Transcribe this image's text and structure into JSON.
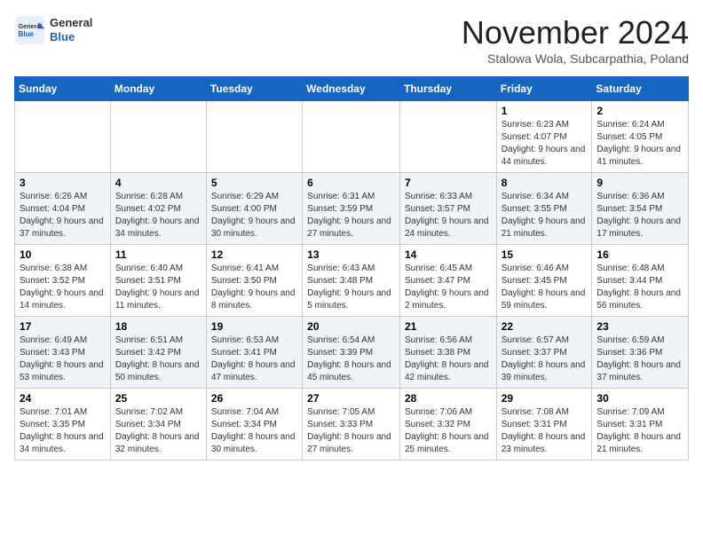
{
  "header": {
    "logo_general": "General",
    "logo_blue": "Blue",
    "month_title": "November 2024",
    "location": "Stalowa Wola, Subcarpathia, Poland"
  },
  "days_of_week": [
    "Sunday",
    "Monday",
    "Tuesday",
    "Wednesday",
    "Thursday",
    "Friday",
    "Saturday"
  ],
  "weeks": [
    [
      {
        "day": "",
        "info": ""
      },
      {
        "day": "",
        "info": ""
      },
      {
        "day": "",
        "info": ""
      },
      {
        "day": "",
        "info": ""
      },
      {
        "day": "",
        "info": ""
      },
      {
        "day": "1",
        "info": "Sunrise: 6:23 AM\nSunset: 4:07 PM\nDaylight: 9 hours and 44 minutes."
      },
      {
        "day": "2",
        "info": "Sunrise: 6:24 AM\nSunset: 4:05 PM\nDaylight: 9 hours and 41 minutes."
      }
    ],
    [
      {
        "day": "3",
        "info": "Sunrise: 6:26 AM\nSunset: 4:04 PM\nDaylight: 9 hours and 37 minutes."
      },
      {
        "day": "4",
        "info": "Sunrise: 6:28 AM\nSunset: 4:02 PM\nDaylight: 9 hours and 34 minutes."
      },
      {
        "day": "5",
        "info": "Sunrise: 6:29 AM\nSunset: 4:00 PM\nDaylight: 9 hours and 30 minutes."
      },
      {
        "day": "6",
        "info": "Sunrise: 6:31 AM\nSunset: 3:59 PM\nDaylight: 9 hours and 27 minutes."
      },
      {
        "day": "7",
        "info": "Sunrise: 6:33 AM\nSunset: 3:57 PM\nDaylight: 9 hours and 24 minutes."
      },
      {
        "day": "8",
        "info": "Sunrise: 6:34 AM\nSunset: 3:55 PM\nDaylight: 9 hours and 21 minutes."
      },
      {
        "day": "9",
        "info": "Sunrise: 6:36 AM\nSunset: 3:54 PM\nDaylight: 9 hours and 17 minutes."
      }
    ],
    [
      {
        "day": "10",
        "info": "Sunrise: 6:38 AM\nSunset: 3:52 PM\nDaylight: 9 hours and 14 minutes."
      },
      {
        "day": "11",
        "info": "Sunrise: 6:40 AM\nSunset: 3:51 PM\nDaylight: 9 hours and 11 minutes."
      },
      {
        "day": "12",
        "info": "Sunrise: 6:41 AM\nSunset: 3:50 PM\nDaylight: 9 hours and 8 minutes."
      },
      {
        "day": "13",
        "info": "Sunrise: 6:43 AM\nSunset: 3:48 PM\nDaylight: 9 hours and 5 minutes."
      },
      {
        "day": "14",
        "info": "Sunrise: 6:45 AM\nSunset: 3:47 PM\nDaylight: 9 hours and 2 minutes."
      },
      {
        "day": "15",
        "info": "Sunrise: 6:46 AM\nSunset: 3:45 PM\nDaylight: 8 hours and 59 minutes."
      },
      {
        "day": "16",
        "info": "Sunrise: 6:48 AM\nSunset: 3:44 PM\nDaylight: 8 hours and 56 minutes."
      }
    ],
    [
      {
        "day": "17",
        "info": "Sunrise: 6:49 AM\nSunset: 3:43 PM\nDaylight: 8 hours and 53 minutes."
      },
      {
        "day": "18",
        "info": "Sunrise: 6:51 AM\nSunset: 3:42 PM\nDaylight: 8 hours and 50 minutes."
      },
      {
        "day": "19",
        "info": "Sunrise: 6:53 AM\nSunset: 3:41 PM\nDaylight: 8 hours and 47 minutes."
      },
      {
        "day": "20",
        "info": "Sunrise: 6:54 AM\nSunset: 3:39 PM\nDaylight: 8 hours and 45 minutes."
      },
      {
        "day": "21",
        "info": "Sunrise: 6:56 AM\nSunset: 3:38 PM\nDaylight: 8 hours and 42 minutes."
      },
      {
        "day": "22",
        "info": "Sunrise: 6:57 AM\nSunset: 3:37 PM\nDaylight: 8 hours and 39 minutes."
      },
      {
        "day": "23",
        "info": "Sunrise: 6:59 AM\nSunset: 3:36 PM\nDaylight: 8 hours and 37 minutes."
      }
    ],
    [
      {
        "day": "24",
        "info": "Sunrise: 7:01 AM\nSunset: 3:35 PM\nDaylight: 8 hours and 34 minutes."
      },
      {
        "day": "25",
        "info": "Sunrise: 7:02 AM\nSunset: 3:34 PM\nDaylight: 8 hours and 32 minutes."
      },
      {
        "day": "26",
        "info": "Sunrise: 7:04 AM\nSunset: 3:34 PM\nDaylight: 8 hours and 30 minutes."
      },
      {
        "day": "27",
        "info": "Sunrise: 7:05 AM\nSunset: 3:33 PM\nDaylight: 8 hours and 27 minutes."
      },
      {
        "day": "28",
        "info": "Sunrise: 7:06 AM\nSunset: 3:32 PM\nDaylight: 8 hours and 25 minutes."
      },
      {
        "day": "29",
        "info": "Sunrise: 7:08 AM\nSunset: 3:31 PM\nDaylight: 8 hours and 23 minutes."
      },
      {
        "day": "30",
        "info": "Sunrise: 7:09 AM\nSunset: 3:31 PM\nDaylight: 8 hours and 21 minutes."
      }
    ]
  ]
}
